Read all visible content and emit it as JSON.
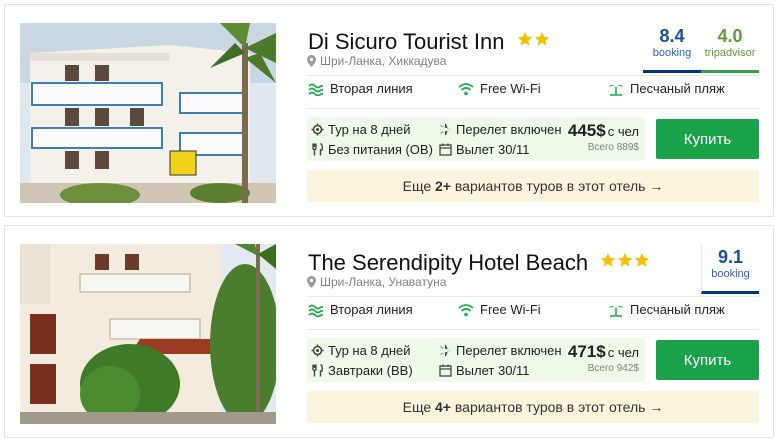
{
  "hotels": [
    {
      "name": "Di Sicuro Tourist Inn",
      "stars": 2,
      "location": "Шри-Ланка, Хиккадува",
      "ratings": [
        {
          "score": "8.4",
          "source": "booking"
        },
        {
          "score": "4.0",
          "source": "tripadvisor"
        }
      ],
      "features": {
        "line": "Вторая линия",
        "wifi": "Free Wi-Fi",
        "beach": "Песчаный пляж"
      },
      "tour": {
        "duration": "Тур на 8 дней",
        "meal": "Без питания (ОВ)",
        "flight": "Перелет включен",
        "departure": "Вылет 30/11",
        "price": "445$",
        "per": "с чел",
        "total": "Всего 889$"
      },
      "buy_label": "Купить",
      "more": {
        "prefix": "Еще",
        "count": "2+",
        "suffix": "вариантов туров в этот отель →"
      }
    },
    {
      "name": "The Serendipity Hotel Beach",
      "stars": 3,
      "location": "Шри-Ланка, Унаватуна",
      "ratings": [
        {
          "score": "9.1",
          "source": "booking"
        }
      ],
      "features": {
        "line": "Вторая линия",
        "wifi": "Free Wi-Fi",
        "beach": "Песчаный пляж"
      },
      "tour": {
        "duration": "Тур на 8 дней",
        "meal": "Завтраки (BB)",
        "flight": "Перелет включен",
        "departure": "Вылет 30/11",
        "price": "471$",
        "per": "с чел",
        "total": "Всего 942$"
      },
      "buy_label": "Купить",
      "more": {
        "prefix": "Еще",
        "count": "4+",
        "suffix": "вариантов туров в этот отель →"
      }
    }
  ],
  "colors": {
    "buy": "#1aa24a",
    "offer_bg": "#eef9e9",
    "more_bg": "#fbf4dd",
    "star": "#f2c200",
    "booking": "#003580",
    "tripadvisor": "#34a344"
  }
}
